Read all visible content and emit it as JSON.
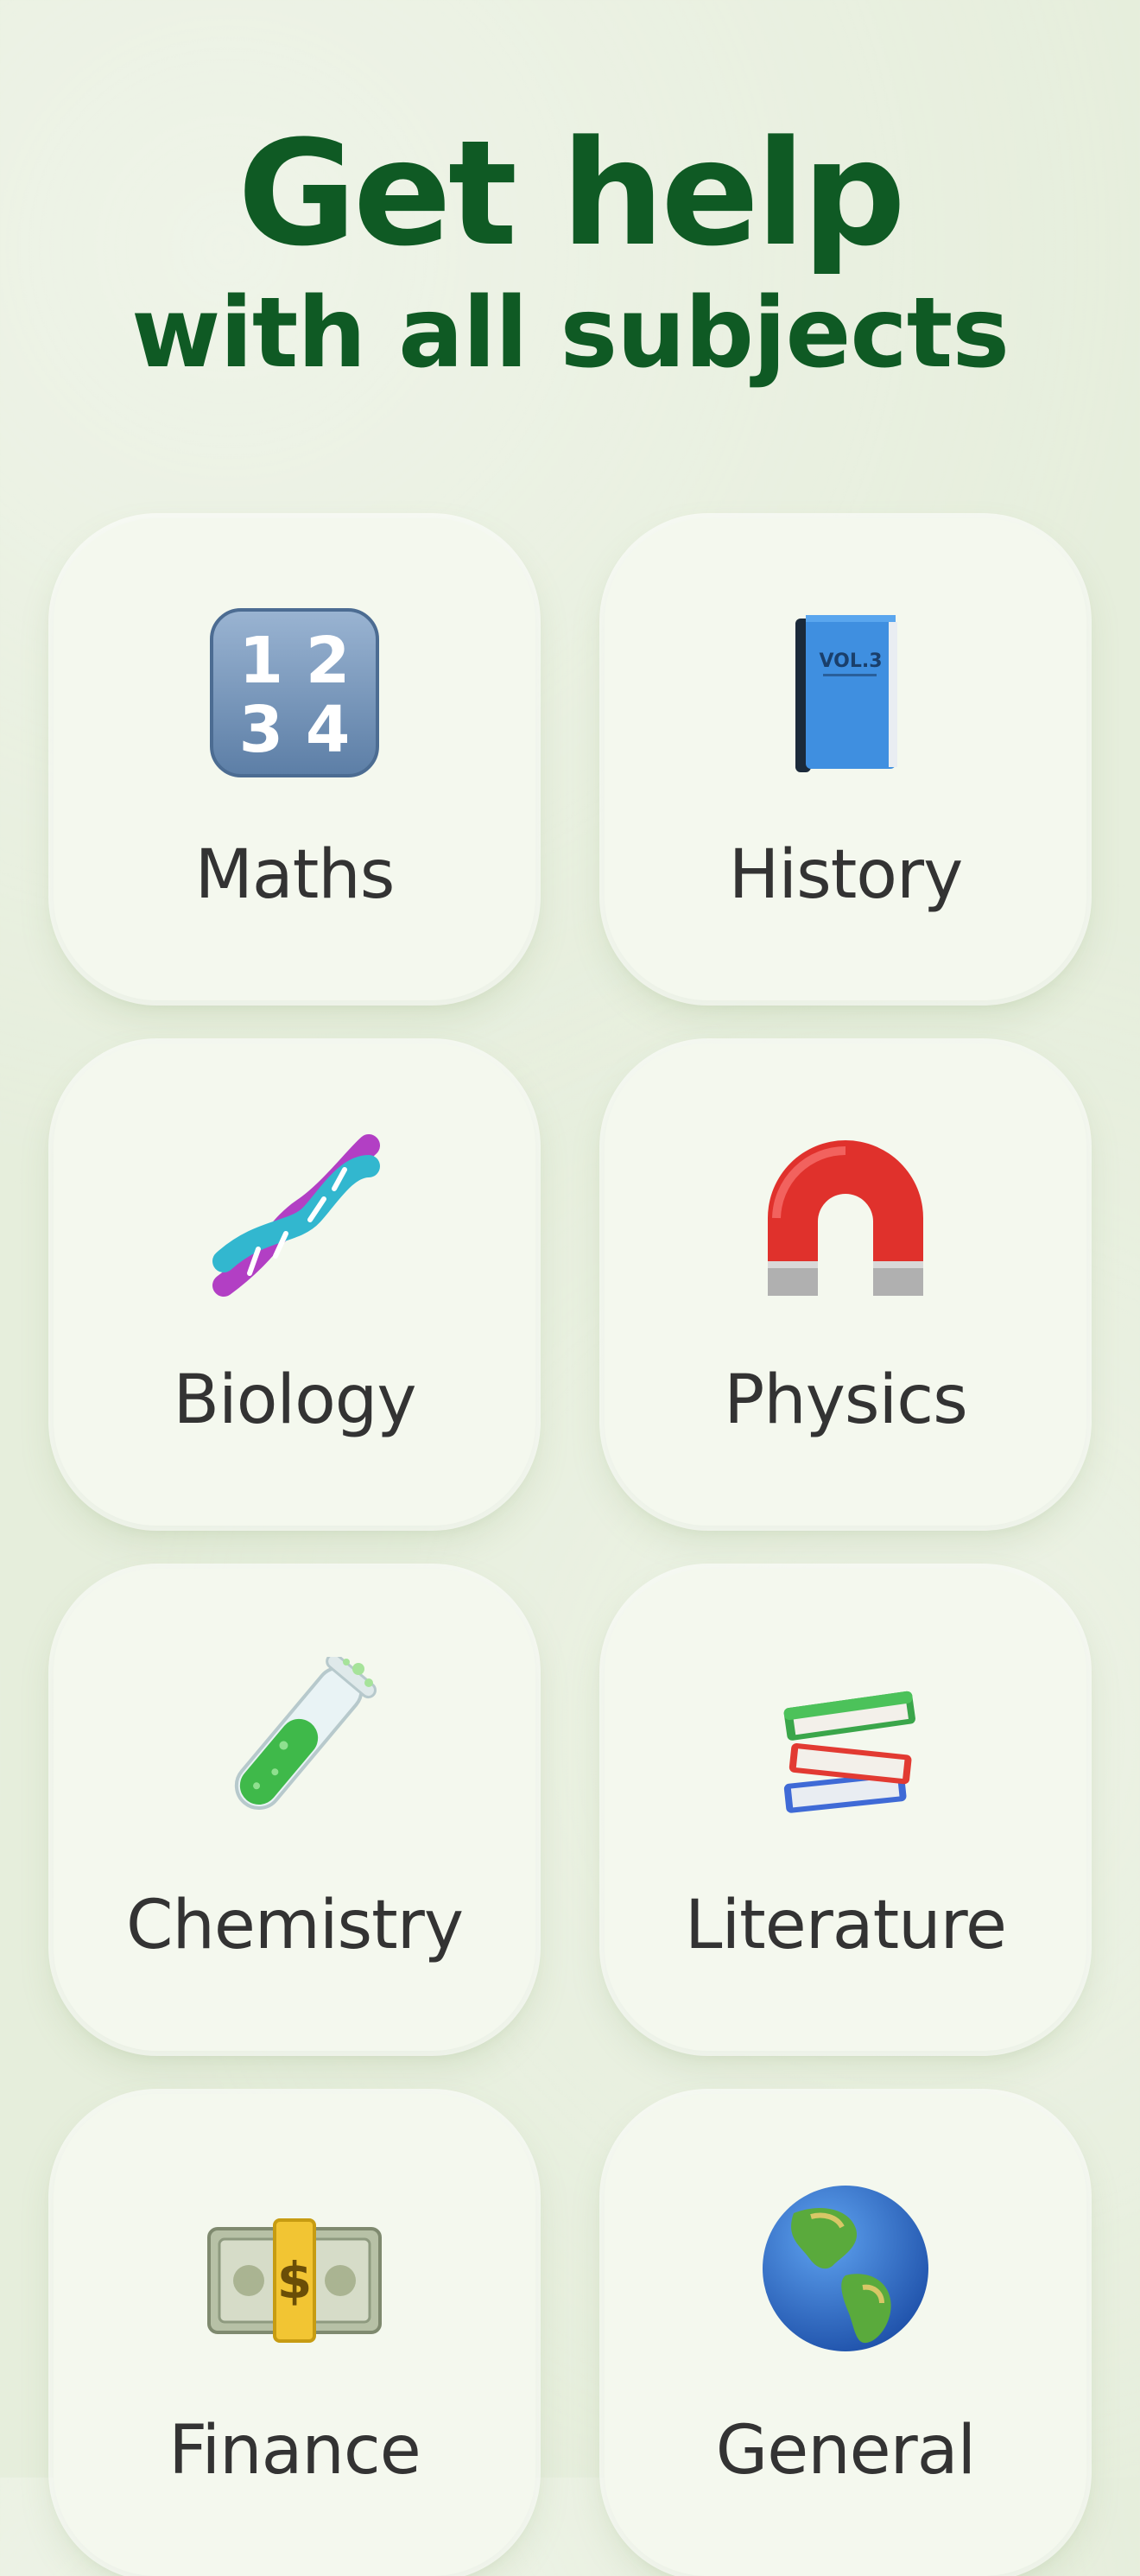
{
  "header": {
    "title": "Get help",
    "subtitle": "with all subjects"
  },
  "colors": {
    "background": "#e6eedc",
    "title": "#0f5a24",
    "card": "#f4f8ee",
    "label": "#333333"
  },
  "subjects": [
    {
      "label": "Maths",
      "icon": "numbers-1234-icon"
    },
    {
      "label": "History",
      "icon": "blue-book-icon",
      "icon_text": "VOL.3"
    },
    {
      "label": "Biology",
      "icon": "dna-icon"
    },
    {
      "label": "Physics",
      "icon": "magnet-icon"
    },
    {
      "label": "Chemistry",
      "icon": "test-tube-icon"
    },
    {
      "label": "Literature",
      "icon": "books-stack-icon"
    },
    {
      "label": "Finance",
      "icon": "money-stack-icon",
      "icon_text": "$"
    },
    {
      "label": "General",
      "icon": "globe-icon"
    }
  ]
}
